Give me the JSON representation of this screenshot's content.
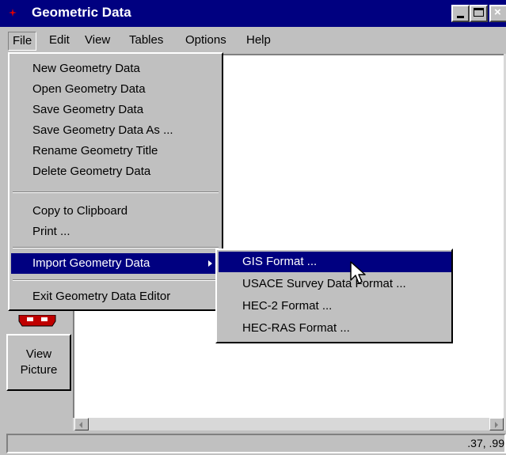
{
  "window": {
    "title": "Geometric Data"
  },
  "menubar": {
    "items": [
      "File",
      "Edit",
      "View",
      "Tables",
      "Options",
      "Help"
    ]
  },
  "file_menu": {
    "items": [
      "New Geometry Data",
      "Open Geometry Data",
      "Save Geometry Data",
      "Save Geometry Data As ...",
      "Rename Geometry Title",
      "Delete Geometry Data",
      "Copy to Clipboard",
      "Print ...",
      "Import Geometry Data",
      "Exit Geometry Data Editor"
    ],
    "highlighted": "Import Geometry Data"
  },
  "import_submenu": {
    "items": [
      "GIS Format ...",
      "USACE Survey Data Format ...",
      "HEC-2 Format ...",
      "HEC-RAS Format ..."
    ],
    "highlighted": "GIS Format ..."
  },
  "toolbar": {
    "view_picture_line1": "View",
    "view_picture_line2": "Picture"
  },
  "status": {
    "coords": ".37, .99"
  },
  "colors": {
    "titlebar": "#000080",
    "highlight": "#000080",
    "face": "#c0c0c0",
    "tool_red": "#c00000"
  },
  "icons": [
    "app-icon",
    "minimize-icon",
    "maximize-icon",
    "close-icon",
    "submenu-arrow-icon",
    "mouse-pointer-icon"
  ]
}
